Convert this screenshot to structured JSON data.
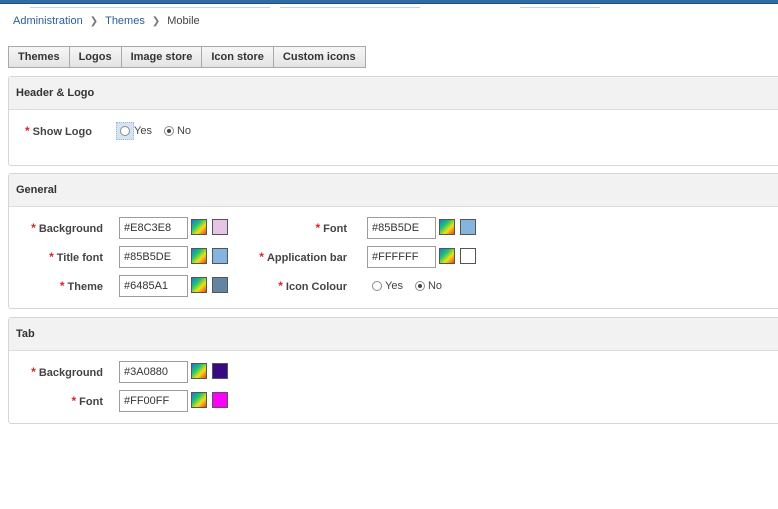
{
  "breadcrumb": {
    "root": "Administration",
    "middle": "Themes",
    "current": "Mobile"
  },
  "tabs": [
    "Themes",
    "Logos",
    "Image store",
    "Icon store",
    "Custom icons"
  ],
  "header_logo": {
    "title": "Header & Logo",
    "show_logo_label": "Show Logo",
    "yes_label": "Yes",
    "no_label": "No",
    "selected": "No"
  },
  "general": {
    "title": "General",
    "background_label": "Background",
    "background_value": "#E8C3E8",
    "background_color": "#E8C3E8",
    "font_label": "Font",
    "font_value": "#85B5DE",
    "font_color": "#85B5DE",
    "title_font_label": "Title font",
    "title_font_value": "#85B5DE",
    "title_font_color": "#85B5DE",
    "app_bar_label": "Application bar",
    "app_bar_value": "#FFFFFF",
    "app_bar_color": "#FFFFFF",
    "theme_label": "Theme",
    "theme_value": "#6485A1",
    "theme_color": "#6485A1",
    "icon_colour_label": "Icon Colour",
    "yes_label": "Yes",
    "no_label": "No",
    "icon_colour_selected": "No"
  },
  "tab_section": {
    "title": "Tab",
    "background_label": "Background",
    "background_value": "#3A0880",
    "background_color": "#3A0880",
    "font_label": "Font",
    "font_value": "#FF00FF",
    "font_color": "#FF00FF"
  },
  "icons": {
    "picker": "color-picker-icon",
    "separator": "chevron-right-icon"
  },
  "colors": {
    "link": "#2a5d9f",
    "required": "#e0242a",
    "topbar": "#2e6da4"
  }
}
